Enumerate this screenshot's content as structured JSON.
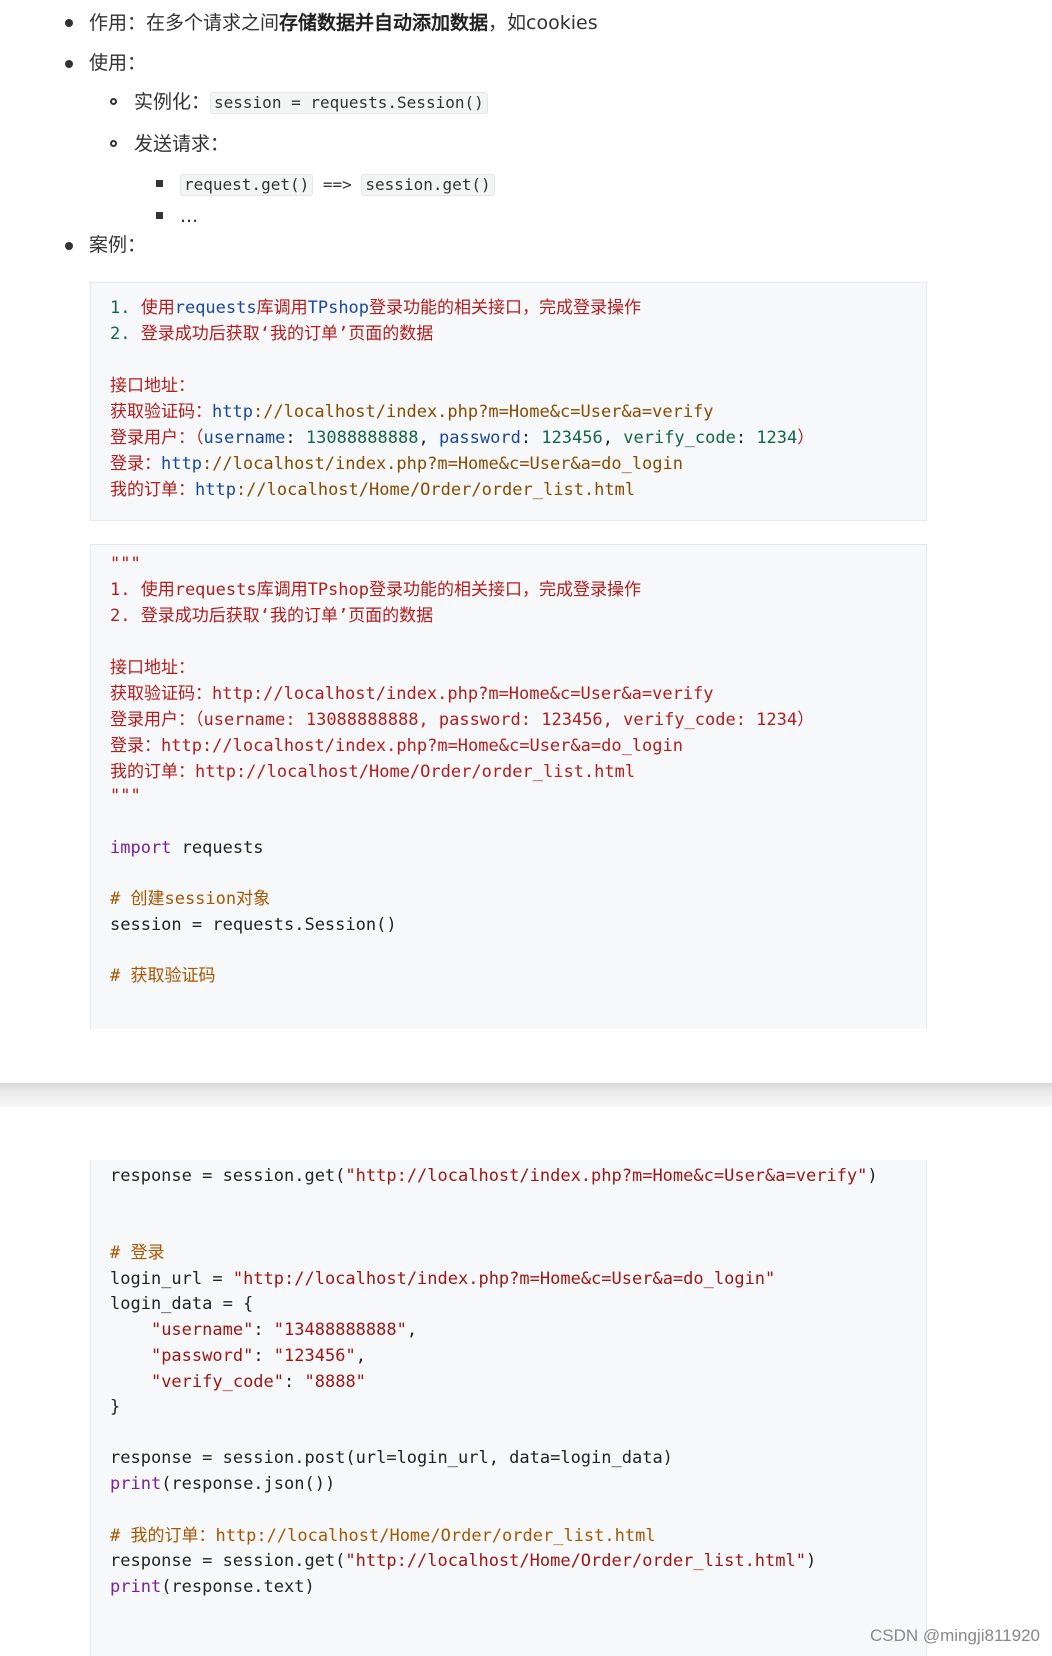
{
  "list": {
    "item1_prefix": "作用：在多个请求之间",
    "item1_bold": "存储数据并自动添加数据",
    "item1_suffix": "，如cookies",
    "item2": "使用：",
    "sub1_label": "实例化：",
    "sub1_code": "session = requests.Session()",
    "sub2_label": "发送请求：",
    "subsub1_code_a": "request.get()",
    "subsub1_arrow": " ==> ",
    "subsub1_code_b": "session.get()",
    "subsub2": "...",
    "item3": "案例："
  },
  "box1": {
    "l1_num": "1. ",
    "l1_a": "使用",
    "l1_b": "requests",
    "l1_c": "库调用",
    "l1_d": "TPshop",
    "l1_e": "登录功能的相关接口，完成登录操作",
    "l2_num": "2. ",
    "l2_a": "登录成功后获取‘我的订单’页面的数据",
    "l4": "接口地址：",
    "l5_a": "获取验证码：",
    "l5_b": "http",
    "l5_c": "://localhost/index.php?m=Home&c=User&a=verify",
    "l6_a": "登录用户：（",
    "l6_b": "username",
    "l6_c": ": ",
    "l6_d": "13088888888",
    "l6_e": ", ",
    "l6_f": "password",
    "l6_g": ": ",
    "l6_h": "123456",
    "l6_i": ", ",
    "l6_j": "verify_code",
    "l6_k": ": ",
    "l6_l": "1234",
    "l6_m": "）",
    "l7_a": "登录：",
    "l7_b": "http",
    "l7_c": "://localhost/index.php?m=Home&c=User&a=do_login",
    "l8_a": "我的订单：",
    "l8_b": "http",
    "l8_c": "://localhost/Home/Order/order_list.html"
  },
  "box2": {
    "l1": "\"\"\"",
    "l2": "1. 使用requests库调用TPshop登录功能的相关接口，完成登录操作",
    "l3": "2. 登录成功后获取‘我的订单’页面的数据",
    "l5": "接口地址：",
    "l6": "获取验证码：http://localhost/index.php?m=Home&c=User&a=verify",
    "l7": "登录用户：（username: 13088888888, password: 123456, verify_code: 1234）",
    "l8": "登录：http://localhost/index.php?m=Home&c=User&a=do_login",
    "l9": "我的订单：http://localhost/Home/Order/order_list.html",
    "l10": "\"\"\"",
    "l12_kw": "import",
    "l12_rest": " requests",
    "l14": "# 创建session对象",
    "l15": "session = requests.Session()",
    "l17": "# 获取验证码"
  },
  "box3": {
    "l1_a": "response = session.get(",
    "l1_b": "\"http://localhost/index.php?m=Home&c=User&a=verify\"",
    "l1_c": ")",
    "l4": "# 登录",
    "l5_a": "login_url = ",
    "l5_b": "\"http://localhost/index.php?m=Home&c=User&a=do_login\"",
    "l6": "login_data = {",
    "l7_a": "    ",
    "l7_b": "\"username\"",
    "l7_c": ": ",
    "l7_d": "\"13488888888\"",
    "l7_e": ",",
    "l8_a": "    ",
    "l8_b": "\"password\"",
    "l8_c": ": ",
    "l8_d": "\"123456\"",
    "l8_e": ",",
    "l9_a": "    ",
    "l9_b": "\"verify_code\"",
    "l9_c": ": ",
    "l9_d": "\"8888\"",
    "l10": "}",
    "l12": "response = session.post(url=login_url, data=login_data)",
    "l13_kw": "print",
    "l13_rest": "(response.json())",
    "l15": "# 我的订单：http://localhost/Home/Order/order_list.html",
    "l16_a": "response = session.get(",
    "l16_b": "\"http://localhost/Home/Order/order_list.html\"",
    "l16_c": ")",
    "l17_kw": "print",
    "l17_rest": "(response.text)"
  },
  "watermark": "CSDN @mingji811920"
}
